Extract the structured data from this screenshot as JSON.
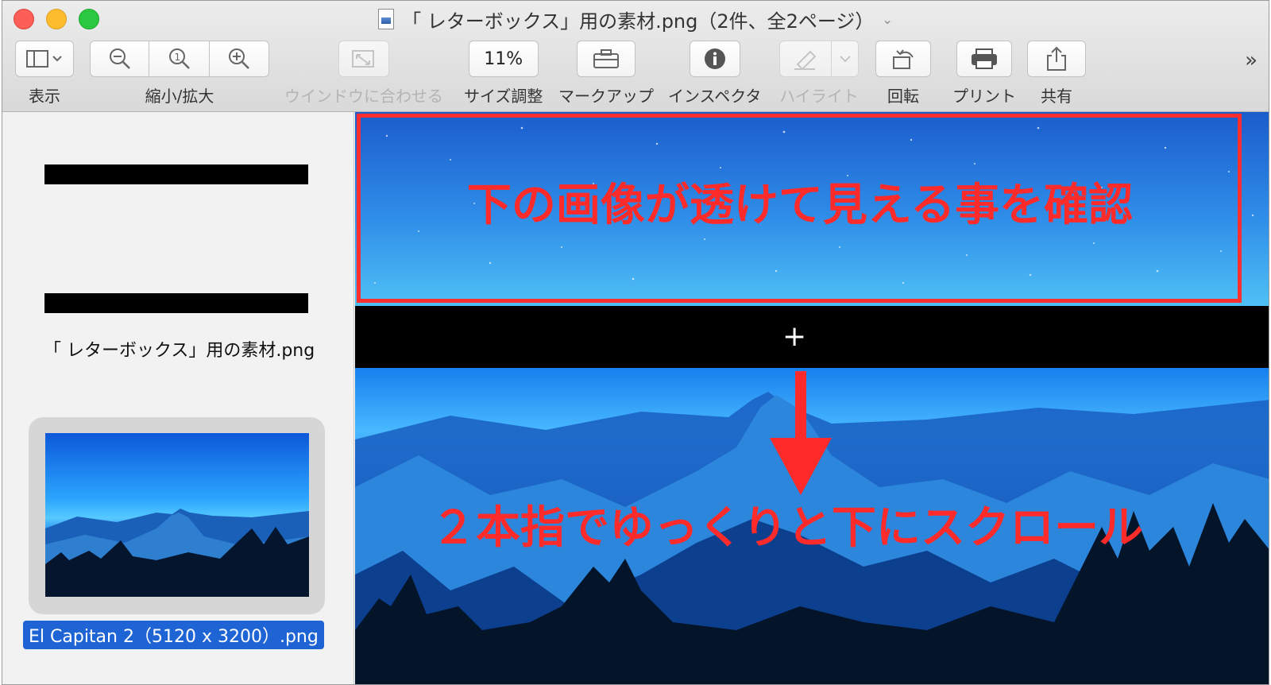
{
  "window": {
    "title": "「 レターボックス」用の素材.png（2件、全2ページ）",
    "title_chevron": "⌄"
  },
  "toolbar": {
    "view": {
      "label": "表示",
      "icon": "sidebar-toggle-icon",
      "chevron": "⌄"
    },
    "zoom": {
      "label": "縮小/拡大",
      "icons": [
        "zoom-out-icon",
        "actual-size-icon",
        "zoom-in-icon"
      ]
    },
    "fit": {
      "label": "ウインドウに合わせる",
      "icon": "fit-window-icon",
      "disabled": true
    },
    "size": {
      "label": "サイズ調整",
      "value": "11%"
    },
    "markup": {
      "label": "マークアップ",
      "icon": "toolbox-icon"
    },
    "inspector": {
      "label": "インスペクタ",
      "icon": "info-icon"
    },
    "highlight": {
      "label": "ハイライト",
      "icon": "highlighter-icon",
      "disabled": true
    },
    "rotate": {
      "label": "回転",
      "icon": "rotate-icon"
    },
    "print": {
      "label": "プリント",
      "icon": "printer-icon"
    },
    "share": {
      "label": "共有",
      "icon": "share-icon"
    },
    "overflow": "»"
  },
  "sidebar": {
    "items": [
      {
        "filename": "「 レターボックス」用の素材.png",
        "selected": false
      },
      {
        "filename": "El Capitan 2（5120 x 3200）.png",
        "selected": true
      }
    ]
  },
  "annotations": {
    "top_text": "下の画像が透けて見える事を確認",
    "bottom_text": "２本指でゆっくりと下にスクロール",
    "crosshair": "+",
    "color": "#ff2a2a"
  },
  "colors": {
    "selection": "#1e64d4",
    "annotation_red": "#ff2a2a"
  }
}
